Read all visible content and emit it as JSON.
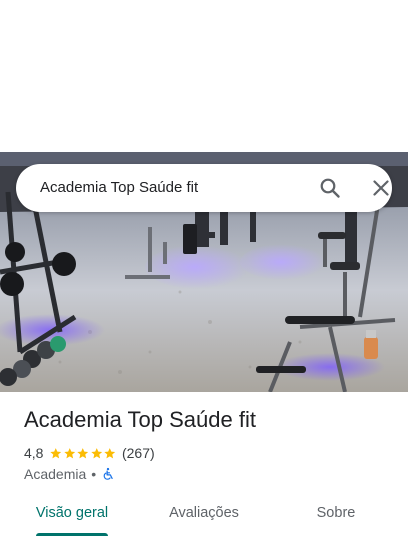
{
  "search": {
    "query": "Academia Top Saúde fit"
  },
  "place": {
    "name": "Academia Top Saúde fit",
    "rating": "4,8",
    "stars": 5,
    "review_count": "(267)",
    "category": "Academia",
    "separator": "•",
    "accessibility_icon": "wheelchair-icon"
  },
  "tabs": [
    {
      "label": "Visão geral",
      "active": true
    },
    {
      "label": "Avaliações",
      "active": false
    },
    {
      "label": "Sobre",
      "active": false
    }
  ],
  "colors": {
    "accent": "#00736b",
    "star": "#fbbc04",
    "accessibility": "#1a73e8"
  }
}
